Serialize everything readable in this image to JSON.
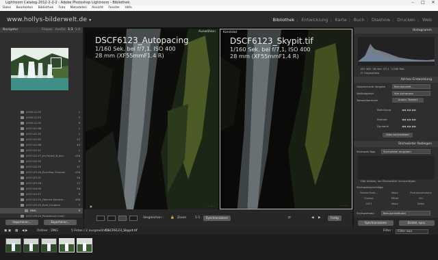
{
  "window": {
    "title": "Lightroom Catalog-2012-2-2-2 - Adobe Photoshop Lightroom - Bibliothek"
  },
  "menu": [
    "Datei",
    "Bearbeiten",
    "Bibliothek",
    "Foto",
    "Metadaten",
    "Ansicht",
    "Fenster",
    "Hilfe"
  ],
  "identity_plate": "www.hollys-bilderwelt.de",
  "modules": [
    "Bibliothek",
    "Entwicklung",
    "Karte",
    "Buch",
    "Diashow",
    "Drucken",
    "Web"
  ],
  "active_module": "Bibliothek",
  "navigator": {
    "title": "Navigator",
    "zoom_options": [
      "Einpas.",
      "Ausfül.",
      "1:1",
      "1:4"
    ]
  },
  "folders": [
    {
      "name": "2016-12-22",
      "count": "1"
    },
    {
      "name": "2016-12-23",
      "count": "3"
    },
    {
      "name": "2016-12-30",
      "count": "6"
    },
    {
      "name": "2017-01-08",
      "count": "1"
    },
    {
      "name": "2017-01-22",
      "count": "1"
    },
    {
      "name": "2017-02-02",
      "count": "23"
    },
    {
      "name": "2017-02-08",
      "count": "43"
    },
    {
      "name": "2017-02-11",
      "count": "1"
    },
    {
      "name": "2017-02-17_Im Forest_B_Kor...",
      "count": "136"
    },
    {
      "name": "2017-02-22",
      "count": "8"
    },
    {
      "name": "2017-02-25",
      "count": "11"
    },
    {
      "name": "2017-03-18_Rundling Thomas",
      "count": "156"
    },
    {
      "name": "2017-03-21",
      "count": "38"
    },
    {
      "name": "2017-03-28",
      "count": "12"
    },
    {
      "name": "2017-04-09",
      "count": "36"
    },
    {
      "name": "2017-04-17",
      "count": "8"
    },
    {
      "name": "2017-04-20_Hecene Komme...",
      "count": "208"
    },
    {
      "name": "2017-05-25_Split_Kroatien",
      "count": "7"
    },
    {
      "name": "DNG",
      "count": "5"
    },
    {
      "name": "2017-06-04_Portefolio/Lichtel",
      "count": ""
    }
  ],
  "selected_folder": "DNG",
  "left_buttons": {
    "import": "Importieren...",
    "export": "Exportieren..."
  },
  "compare": {
    "left_tag": "Auswählen",
    "right_tag": "Kandidat",
    "left": {
      "filename": "DSCF6123_Autopacing",
      "exif": "1/160 Sek. bei f/7,1, ISO 400",
      "lens": "28 mm (XF55mmF1.4 R)"
    },
    "right": {
      "filename": "DSCF6123_Skypit.tif",
      "exif": "1/160 Sek. bei f/7,1, ISO 400",
      "lens": "28 mm (XF55mmF1.4 R)"
    }
  },
  "toolbar": {
    "compare_label": "Vergleichen :",
    "zoom_label": "Zoom",
    "ratio": "1:1",
    "sync_label": "Synchronisieren",
    "done_label": "Fertig"
  },
  "right_panel": {
    "histogram_title": "Histogramm",
    "histogram_info": [
      "ISO 400",
      "28 mm",
      "f/7,1",
      "1/160 Sek."
    ],
    "original_photo": "Originalfoto",
    "quick_develop_title": "Ad-hoc-Entwicklung",
    "saved_preset_label": "Gespeicherte Vorgabe",
    "saved_preset_value": "Benutzerdefi...",
    "white_balance_label": "Weißabgleich",
    "white_balance_value": "Wie Aufnahme",
    "tone_label": "Tonwertkontrolle",
    "tone_value": "Autom. Tonwert",
    "exposure_label": "Belichtung",
    "clarity_label": "Klarheit",
    "vibrance_label": "Dynamik",
    "reset_all": "Alles zurücksetzen",
    "keyword_title": "Stichwörter festlegen",
    "keyword_tags_label": "Stichwort-Tags",
    "keyword_tags_value": "Stichwörter eingeben",
    "keyword_hint": "Hier klicken, um Stichwörter hinzuzufügen",
    "suggestions_title": "Stichwortvorschläge",
    "suggestions": [
      "Rheda-Friesl...",
      "Natur",
      "Portraitaufnahme",
      "Sunkist",
      "Effekt",
      "Ort",
      "2017",
      "Natur",
      "Detail"
    ],
    "keyword_set_label": "Stichwortsatz",
    "keyword_set_value": "Benutzerdefiniert",
    "sync_button": "Synchronisieren",
    "sync_settings_button": "Einstel. sync."
  },
  "filmstrip": {
    "folder_label": "Ordner : DNG",
    "info": "5 Fotos / 2 ausgewählt /",
    "selected_file": "DSCF6123_Skypit.tif",
    "filter_label": "Filter :",
    "filter_value": "Filter aus"
  }
}
